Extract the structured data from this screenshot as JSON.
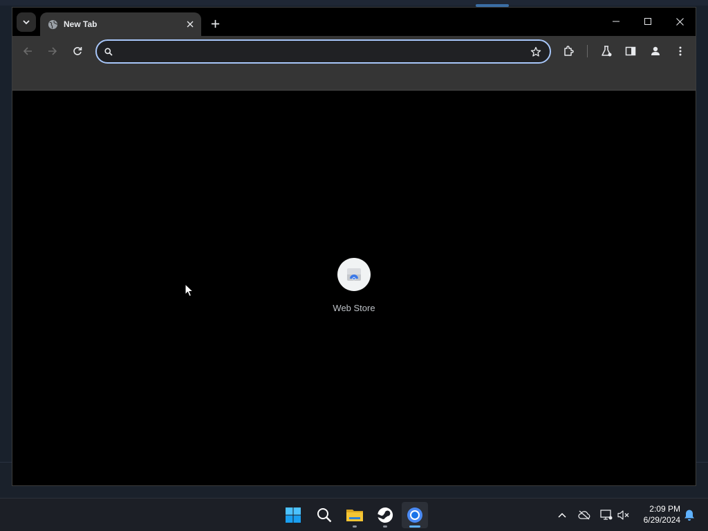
{
  "browser": {
    "tab": {
      "title": "New Tab"
    },
    "omnibox": {
      "value": "",
      "placeholder": ""
    }
  },
  "shortcuts": [
    {
      "label": "Web Store",
      "icon": "web-store-icon"
    }
  ],
  "taskbar": {
    "apps": [
      "windows-start-icon",
      "search-icon",
      "file-explorer-icon",
      "steam-icon",
      "chrome-icon"
    ],
    "clock": {
      "time": "2:09 PM",
      "date": "6/29/2024"
    }
  },
  "colors": {
    "omnibox_focus_ring": "#a8c7fa",
    "toolbar": "#353535",
    "taskbar_active_indicator": "#5fb2ff"
  }
}
